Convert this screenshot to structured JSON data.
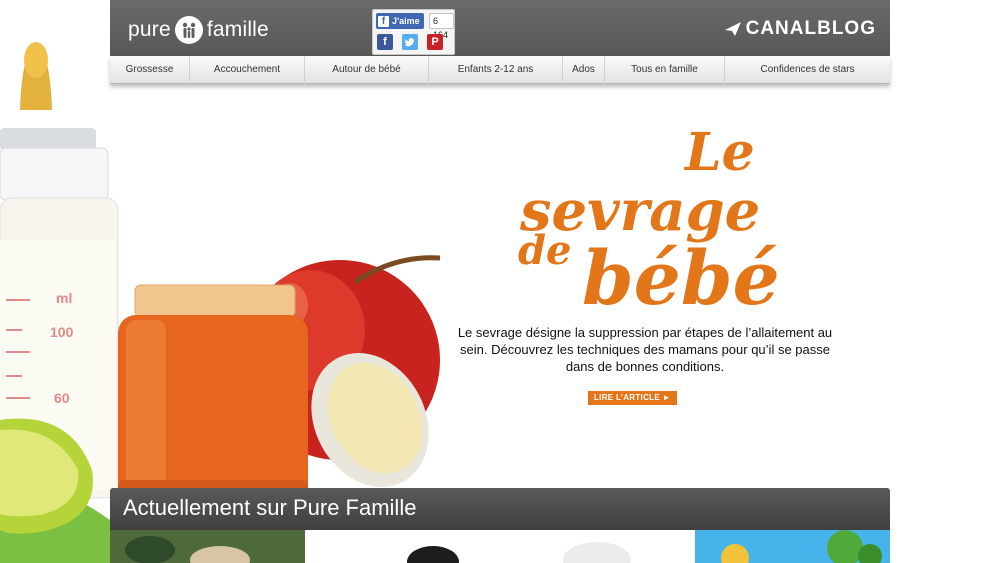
{
  "header": {
    "logo_left": "pure",
    "logo_right": "famille",
    "facebook": {
      "like_label": "J'aime",
      "like_count": "6 164"
    },
    "share_icons": [
      "facebook-icon",
      "twitter-icon",
      "pinterest-icon"
    ],
    "canalblog_label": "CANALBLOG"
  },
  "nav": {
    "items": [
      {
        "label": "Grossesse"
      },
      {
        "label": "Accouchement"
      },
      {
        "label": "Autour de bébé"
      },
      {
        "label": "Enfants 2-12 ans"
      },
      {
        "label": "Ados"
      },
      {
        "label": "Tous en famille"
      },
      {
        "label": "Confidences de stars"
      }
    ]
  },
  "hero": {
    "title_line1": "Le",
    "title_line2": "sevrage",
    "title_line3_a": "de",
    "title_line3_b": "bébé",
    "description": "Le sevrage désigne la suppression par étapes de l’allaitement au sein. Découvrez les techniques des mamans pour qu’il se passe dans de bonnes conditions.",
    "cta_label": "LIRE L’ARTICLE ►",
    "bottle_marks": [
      "ml",
      "100",
      "60"
    ]
  },
  "section": {
    "title": "Actuellement sur Pure Famille"
  },
  "colors": {
    "accent": "#e4761a",
    "header_bg": "#5f5f5f",
    "section_bg": "#4a4a4a"
  }
}
